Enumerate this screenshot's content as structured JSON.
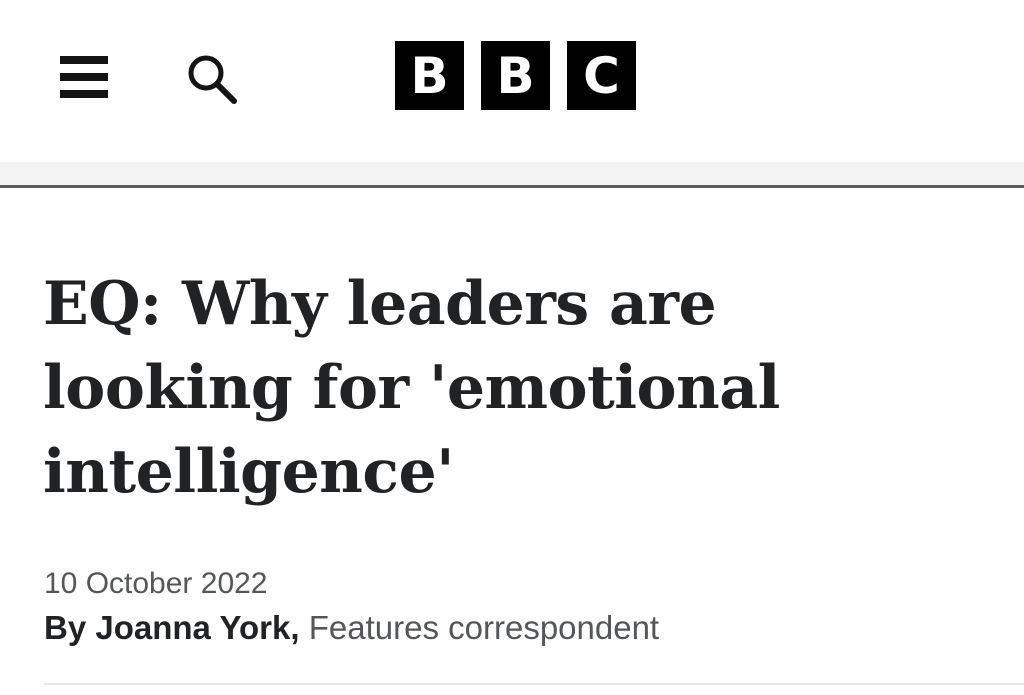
{
  "header": {
    "menu_icon": "hamburger-menu-icon",
    "search_icon": "search-icon",
    "logo": {
      "letters": [
        "B",
        "B",
        "C"
      ]
    }
  },
  "article": {
    "headline": "EQ: Why leaders are looking for 'emotional intelligence'",
    "date": "10 October 2022",
    "byline": {
      "prefix": "By",
      "author": "Joanna York",
      "separator": ",",
      "role": "Features correspondent"
    }
  },
  "colors": {
    "text_primary": "#202224",
    "text_secondary": "#545658",
    "logo_block": "#000000",
    "band": "#f3f3f3"
  }
}
